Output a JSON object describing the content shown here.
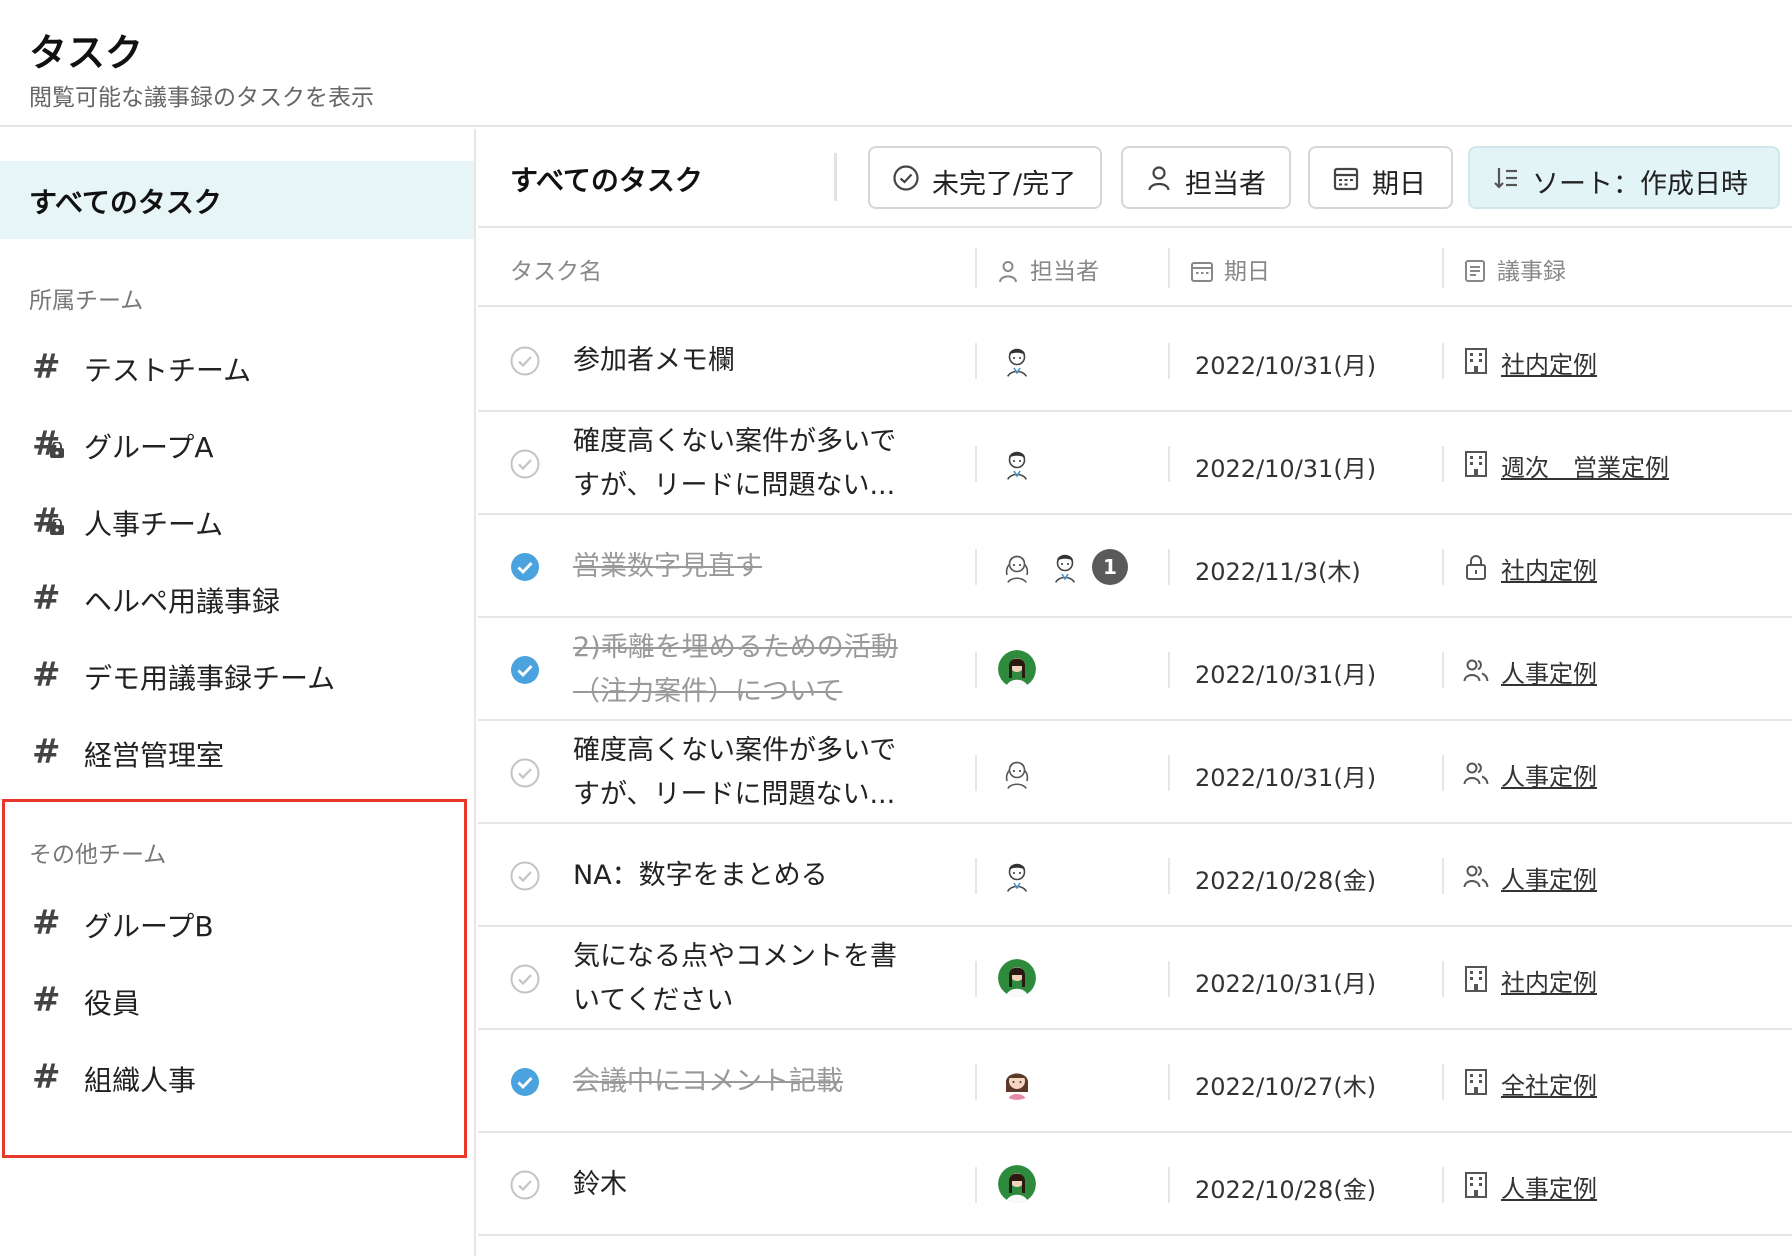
{
  "header": {
    "title": "タスク",
    "subtitle": "閲覧可能な議事録のタスクを表示"
  },
  "sidebar": {
    "all_tasks": "すべてのタスク",
    "own_teams_label": "所属チーム",
    "own_teams": [
      {
        "label": "テストチーム",
        "locked": false
      },
      {
        "label": "グループA",
        "locked": true
      },
      {
        "label": "人事チーム",
        "locked": true
      },
      {
        "label": "ヘルペ用議事録",
        "locked": false
      },
      {
        "label": "デモ用議事録チーム",
        "locked": false
      },
      {
        "label": "経営管理室",
        "locked": false
      }
    ],
    "other_teams_label": "その他チーム",
    "other_teams": [
      {
        "label": "グループB"
      },
      {
        "label": "役員"
      },
      {
        "label": "組織人事"
      }
    ],
    "highlight_color": "#e8372b"
  },
  "toolbar": {
    "title": "すべてのタスク",
    "status_filter": "未完了/完了",
    "assignee_filter": "担当者",
    "due_filter": "期日",
    "sort": "ソート：作成日時"
  },
  "table": {
    "headers": {
      "task": "タスク名",
      "assignee": "担当者",
      "due": "期日",
      "minutes": "議事録"
    },
    "rows": [
      {
        "task_lines": [
          "参加者メモ欄"
        ],
        "done": false,
        "avatars": [
          "man-avatar"
        ],
        "extra_count": "",
        "due": "2022/10/31(月)",
        "minutes_icon": "building-icon",
        "minutes": "社内定例"
      },
      {
        "task_lines": [
          "確度高くない案件が多いで",
          "すが、リードに問題ない..."
        ],
        "done": false,
        "avatars": [
          "man-avatar"
        ],
        "extra_count": "",
        "due": "2022/10/31(月)",
        "minutes_icon": "building-icon",
        "minutes": "週次　営業定例"
      },
      {
        "task_lines": [
          "営業数字見直す"
        ],
        "done": true,
        "avatars": [
          "woman-avatar",
          "man-avatar"
        ],
        "extra_count": "1",
        "due": "2022/11/3(木)",
        "minutes_icon": "lock-icon",
        "minutes": "社内定例"
      },
      {
        "task_lines": [
          "2)乖離を埋めるための活動",
          "（注力案件）について"
        ],
        "done": true,
        "avatars": [
          "photo-avatar"
        ],
        "extra_count": "",
        "due": "2022/10/31(月)",
        "minutes_icon": "people-icon",
        "minutes": "人事定例"
      },
      {
        "task_lines": [
          "確度高くない案件が多いで",
          "すが、リードに問題ない..."
        ],
        "done": false,
        "avatars": [
          "woman-avatar"
        ],
        "extra_count": "",
        "due": "2022/10/31(月)",
        "minutes_icon": "people-icon",
        "minutes": "人事定例"
      },
      {
        "task_lines": [
          "NA：数字をまとめる"
        ],
        "done": false,
        "avatars": [
          "man-avatar"
        ],
        "extra_count": "",
        "due": "2022/10/28(金)",
        "minutes_icon": "people-icon",
        "minutes": "人事定例"
      },
      {
        "task_lines": [
          "気になる点やコメントを書",
          "いてください"
        ],
        "done": false,
        "avatars": [
          "photo-avatar"
        ],
        "extra_count": "",
        "due": "2022/10/31(月)",
        "minutes_icon": "building-icon",
        "minutes": "社内定例"
      },
      {
        "task_lines": [
          "会議中にコメント記載"
        ],
        "done": true,
        "avatars": [
          "girl-avatar"
        ],
        "extra_count": "",
        "due": "2022/10/27(木)",
        "minutes_icon": "building-icon",
        "minutes": "全社定例"
      },
      {
        "task_lines": [
          "鈴木"
        ],
        "done": false,
        "avatars": [
          "photo-avatar"
        ],
        "extra_count": "",
        "due": "2022/10/28(金)",
        "minutes_icon": "building-icon",
        "minutes": "人事定例"
      }
    ]
  },
  "colors": {
    "accent": "#4aa3df",
    "selected_bg": "#e8f5f7",
    "sort_bg": "#e3f4f6"
  }
}
